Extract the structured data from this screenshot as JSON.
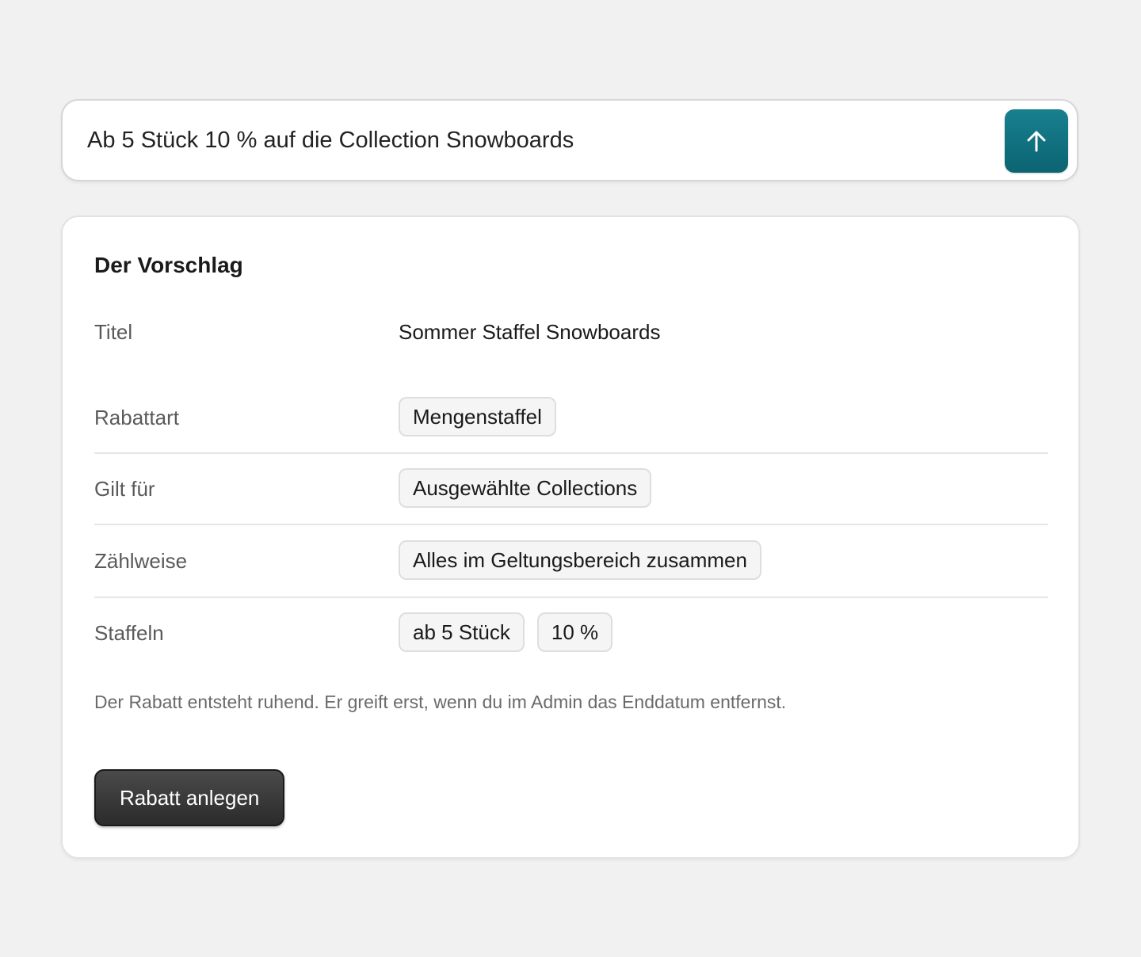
{
  "prompt": {
    "value": "Ab 5 Stück 10 % auf die Collection Snowboards",
    "send_icon": "arrow-up-icon",
    "accent_color": "#11707f"
  },
  "proposal": {
    "title": "Der Vorschlag",
    "rows": [
      {
        "label": "Titel",
        "value": "Sommer Staffel Snowboards"
      },
      {
        "label": "Rabattart",
        "tags": [
          "Mengenstaffel"
        ]
      },
      {
        "label": "Gilt für",
        "tags": [
          "Ausgewählte Collections"
        ]
      },
      {
        "label": "Zählweise",
        "tags": [
          "Alles im Geltungsbereich zusammen"
        ]
      },
      {
        "label": "Staffeln",
        "tags": [
          "ab 5 Stück",
          "10 %"
        ]
      }
    ],
    "note": "Der Rabatt entsteht ruhend. Er greift erst, wenn du im Admin das Enddatum entfernst.",
    "submit_label": "Rabatt anlegen"
  }
}
